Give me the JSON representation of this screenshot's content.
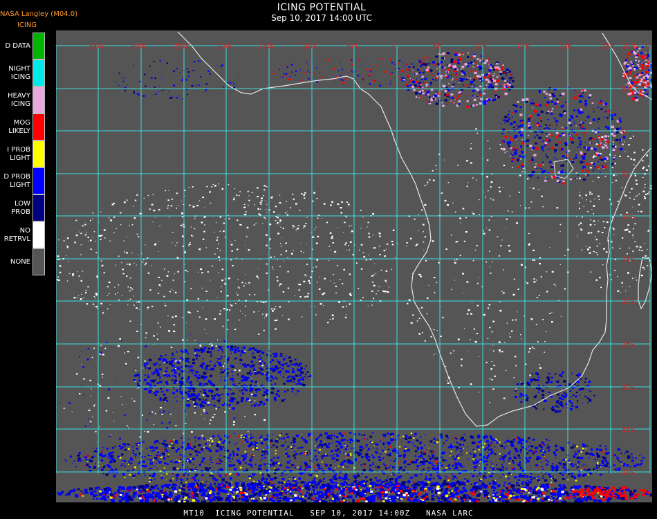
{
  "header": {
    "source": "NASA Langley (M04.0)",
    "legend_title": "ICING",
    "title": "ICING POTENTIAL",
    "subtitle": "Sep 10, 2017 14:00 UTC"
  },
  "legend": [
    {
      "label": "D DATA",
      "color": "#00b400"
    },
    {
      "label": "NIGHT\nICING",
      "color": "#00e8e8"
    },
    {
      "label": "HEAVY\nICING",
      "color": "#e8a8dc"
    },
    {
      "label": "MOG\nLIKELY",
      "color": "#ff0000"
    },
    {
      "label": "I PROB\nLIGHT",
      "color": "#ffff00"
    },
    {
      "label": "D PROB\nLIGHT",
      "color": "#0000ff"
    },
    {
      "label": "LOW\nPROB",
      "color": "#000080"
    },
    {
      "label": "NO\nRETRVL",
      "color": "#ffffff"
    },
    {
      "label": "NONE",
      "color": "#555555"
    }
  ],
  "map": {
    "background_color": "#555555",
    "grid_color": "#3ce0e0",
    "coast_color": "#e8e8e8",
    "lat_label_color": "#e02020",
    "lon_labels": [
      "35W",
      "30W",
      "25W",
      "20W",
      "15W",
      "10W",
      "5W",
      "0",
      "5E",
      "10E",
      "15E",
      "20E",
      "25E",
      "30E"
    ],
    "lat_labels": [
      "5N",
      "0",
      "5S",
      "10S",
      "15S",
      "20S",
      "25S",
      "30S",
      "35S",
      "40S"
    ],
    "top_lat_label": "10N"
  },
  "footer": {
    "text": "MT10  ICING POTENTIAL   SEP 10, 2017 14:00Z   NASA LARC"
  }
}
